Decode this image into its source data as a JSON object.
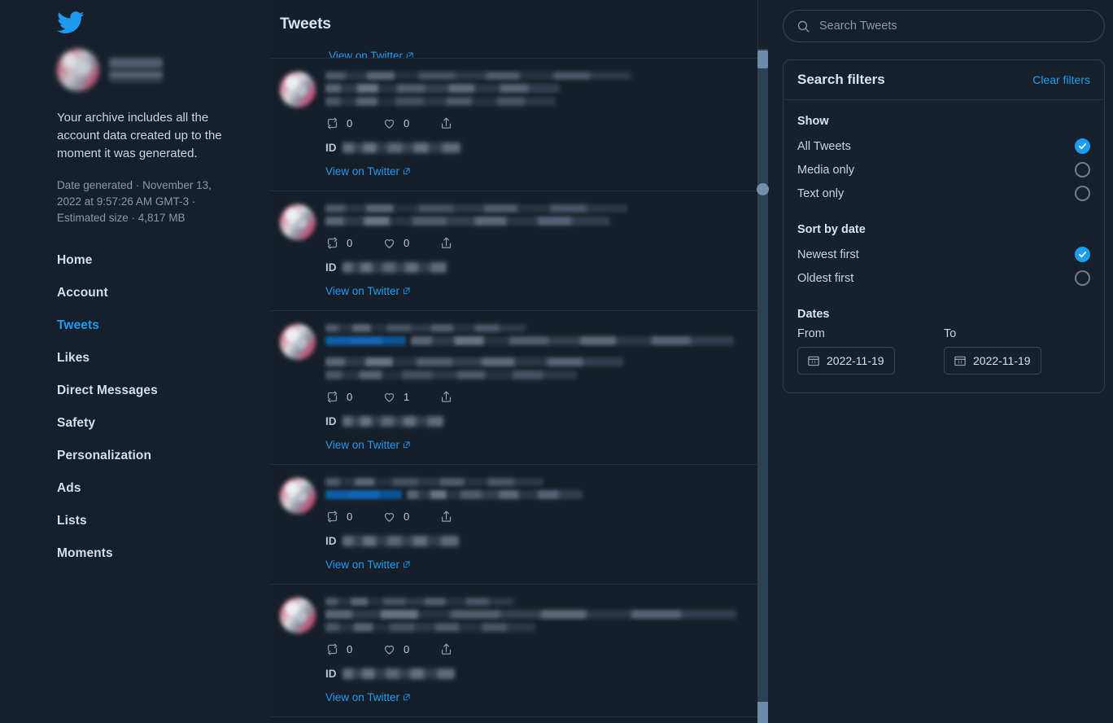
{
  "brand": {
    "logo_icon": "twitter-bird-icon",
    "accent": "#1d9bf0"
  },
  "sidebar": {
    "archive_note": "Your archive includes all the account data created up to the moment it was generated.",
    "date_note": "Date generated · November 13, 2022 at 9:57:26 AM GMT-3 · Estimated size · 4,817 MB",
    "nav": [
      {
        "label": "Home",
        "active": false
      },
      {
        "label": "Account",
        "active": false
      },
      {
        "label": "Tweets",
        "active": true
      },
      {
        "label": "Likes",
        "active": false
      },
      {
        "label": "Direct Messages",
        "active": false
      },
      {
        "label": "Safety",
        "active": false
      },
      {
        "label": "Personalization",
        "active": false
      },
      {
        "label": "Ads",
        "active": false
      },
      {
        "label": "Lists",
        "active": false
      },
      {
        "label": "Moments",
        "active": false
      }
    ]
  },
  "main": {
    "title": "Tweets",
    "id_label": "ID",
    "view_link_label": "View on Twitter",
    "tweets": [
      {
        "retweets": "0",
        "likes": "0",
        "has_mention": false,
        "text_lines": 2,
        "extra_lines": 0
      },
      {
        "retweets": "0",
        "likes": "0",
        "has_mention": false,
        "text_lines": 2,
        "extra_lines": 0
      },
      {
        "retweets": "0",
        "likes": "1",
        "has_mention": true,
        "text_lines": 1,
        "extra_lines": 2
      },
      {
        "retweets": "0",
        "likes": "0",
        "has_mention": true,
        "text_lines": 1,
        "extra_lines": 0
      },
      {
        "retweets": "0",
        "likes": "0",
        "has_mention": false,
        "text_lines": 2,
        "extra_lines": 0
      }
    ]
  },
  "search": {
    "placeholder": "Search Tweets",
    "value": "",
    "icon": "search-icon"
  },
  "filters": {
    "title": "Search filters",
    "clear_label": "Clear filters",
    "show": {
      "group_label": "Show",
      "options": [
        {
          "label": "All Tweets",
          "selected": true
        },
        {
          "label": "Media only",
          "selected": false
        },
        {
          "label": "Text only",
          "selected": false
        }
      ]
    },
    "sort": {
      "group_label": "Sort by date",
      "options": [
        {
          "label": "Newest first",
          "selected": true
        },
        {
          "label": "Oldest first",
          "selected": false
        }
      ]
    },
    "dates": {
      "group_label": "Dates",
      "from_label": "From",
      "from_value": "2022-11-19",
      "to_label": "To",
      "to_value": "2022-11-19",
      "calendar_icon": "calendar-icon"
    }
  }
}
